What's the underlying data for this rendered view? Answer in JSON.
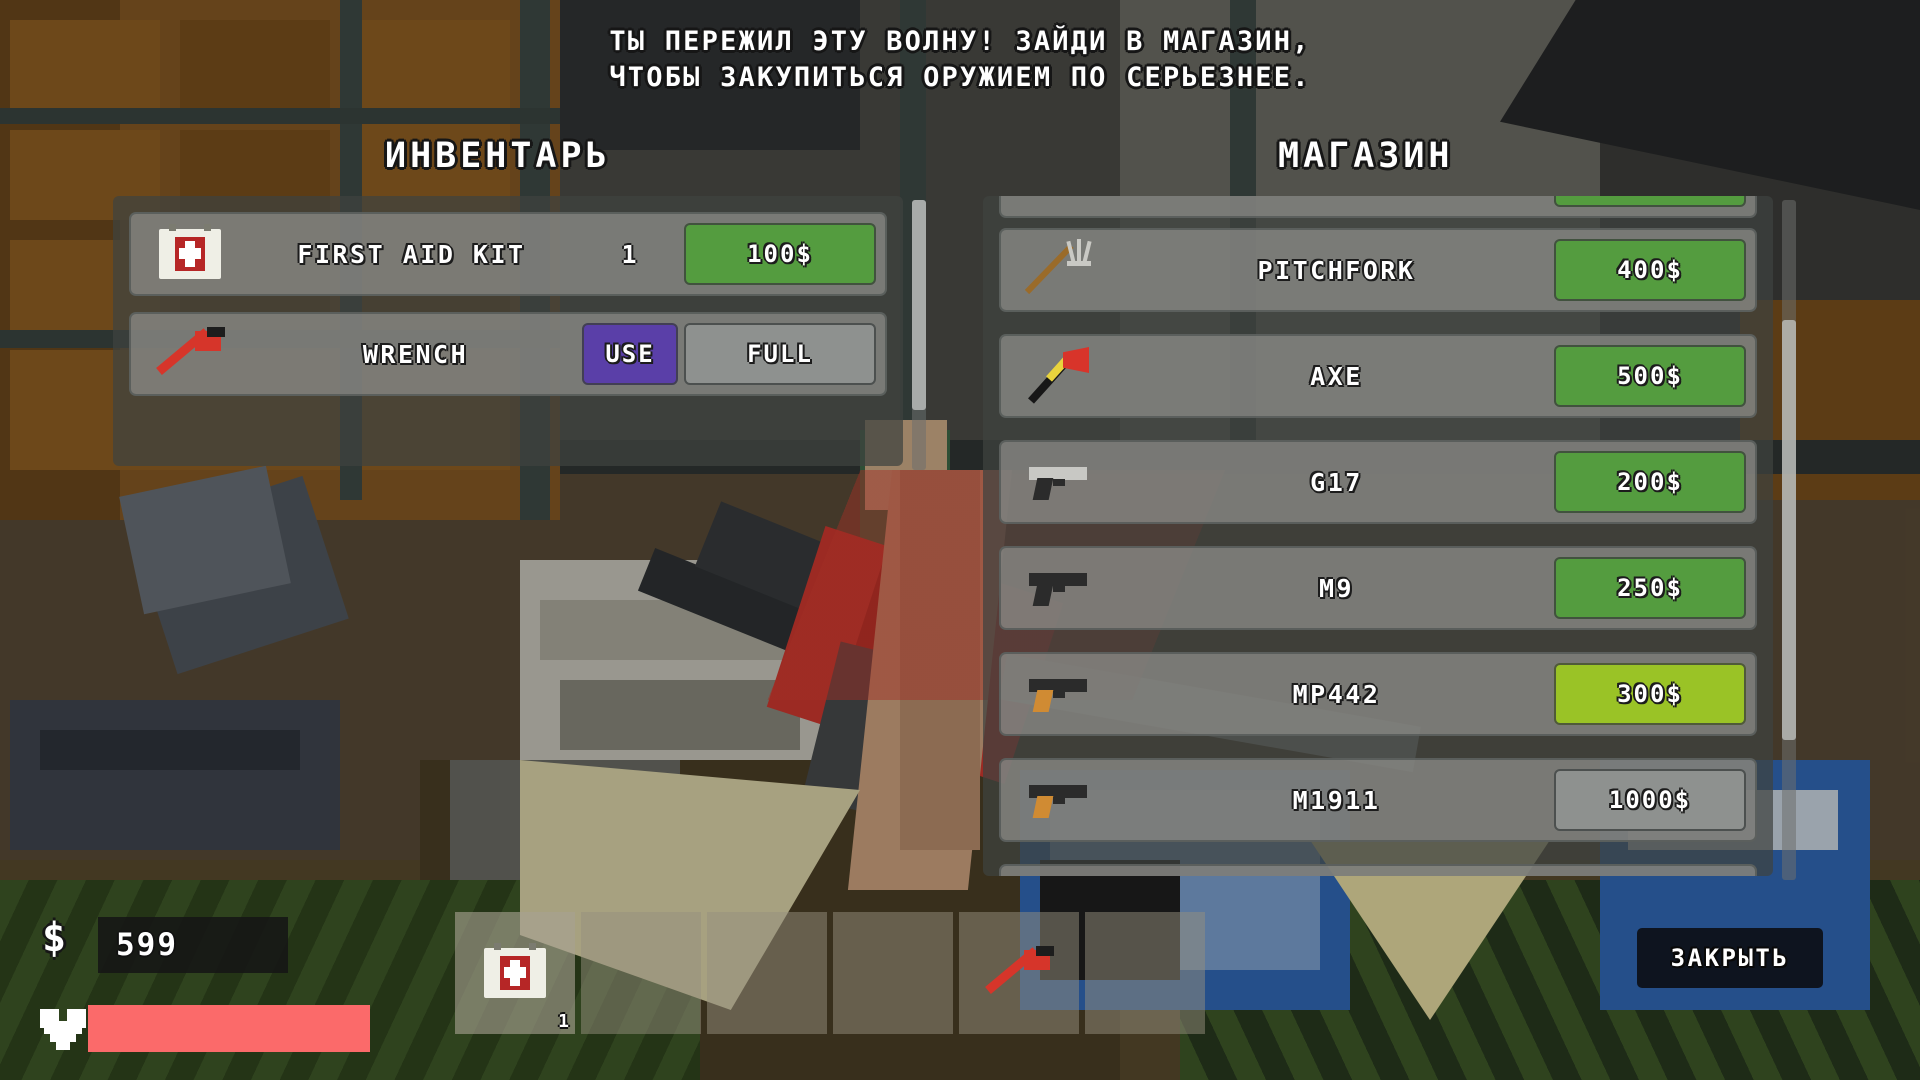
{
  "banner": {
    "line1": "ТЫ ПЕРЕЖИЛ ЭТУ ВОЛНУ! ЗАЙДИ В МАГАЗИН,",
    "line2": "ЧТОБЫ ЗАКУПИТЬСЯ ОРУЖИЕМ ПО СЕРЬЕЗНЕЕ."
  },
  "inventory": {
    "title": "ИНВЕНТАРЬ",
    "items": [
      {
        "icon": "medkit-icon",
        "name": "FIRST AID KIT",
        "qty": "1",
        "price_label": "100$",
        "price_state": "normal"
      },
      {
        "icon": "wrench-icon",
        "name": "WRENCH",
        "qty": "",
        "use_label": "USE",
        "full_label": "FULL"
      }
    ]
  },
  "shop": {
    "title": "МАГАЗИН",
    "items": [
      {
        "icon": "pitchfork-icon",
        "name": "PITCHFORK",
        "price_label": "400$",
        "price_state": "normal"
      },
      {
        "icon": "axe-icon",
        "name": "AXE",
        "price_label": "500$",
        "price_state": "normal"
      },
      {
        "icon": "pistol-silver-icon",
        "name": "G17",
        "price_label": "200$",
        "price_state": "normal"
      },
      {
        "icon": "pistol-black-icon",
        "name": "M9",
        "price_label": "250$",
        "price_state": "normal"
      },
      {
        "icon": "pistol-tan-icon",
        "name": "MP442",
        "price_label": "300$",
        "price_state": "highlight"
      },
      {
        "icon": "pistol-tan-icon",
        "name": "M1911",
        "price_label": "1000$",
        "price_state": "unaffordable"
      }
    ]
  },
  "hud": {
    "money": "599",
    "money_icon": "dollar-icon",
    "health_icon": "heart-icon",
    "health_percent": 100,
    "hotbar": [
      {
        "icon": "medkit-icon",
        "count": "1"
      },
      {
        "icon": "",
        "count": ""
      },
      {
        "icon": "",
        "count": ""
      },
      {
        "icon": "",
        "count": ""
      },
      {
        "icon": "wrench-icon",
        "count": ""
      },
      {
        "icon": "",
        "count": ""
      }
    ]
  },
  "close_button": {
    "label": "ЗАКРЫТЬ"
  },
  "colors": {
    "price_green": "#549c3f",
    "price_highlight": "#9ac326",
    "price_disabled": "#8e918f",
    "use_purple": "#5a3fa8",
    "health_red": "#fb6a6a",
    "close_navy": "#0e141f"
  }
}
